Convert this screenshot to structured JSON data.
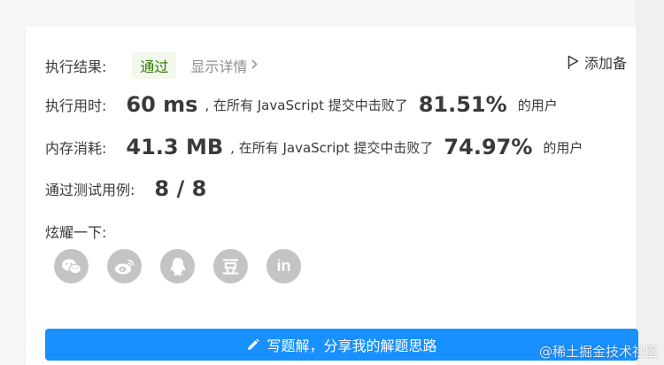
{
  "result": {
    "label": "执行结果:",
    "status": "通过",
    "details_link": "显示详情",
    "add_note": "添加备"
  },
  "runtime": {
    "label": "执行用时:",
    "value": "60 ms",
    "middle_text": ", 在所有 JavaScript 提交中击败了",
    "percent": "81.51%",
    "suffix": "的用户"
  },
  "memory": {
    "label": "内存消耗:",
    "value": "41.3 MB",
    "middle_text": ", 在所有 JavaScript 提交中击败了",
    "percent": "74.97%",
    "suffix": "的用户"
  },
  "testcases": {
    "label": "通过测试用例:",
    "value": "8 / 8"
  },
  "share": {
    "label": "炫耀一下:",
    "icons": [
      "wechat-icon",
      "weibo-icon",
      "qq-icon",
      "douban-icon",
      "linkedin-icon"
    ],
    "douban_glyph": "豆",
    "linkedin_glyph": "in"
  },
  "write_solution": {
    "label": "写题解，分享我的解题思路"
  },
  "watermark": "@稀土掘金技术社区",
  "colors": {
    "primary": "#1890ff",
    "success_text": "#2d7a00",
    "success_bg": "#f2f9ec",
    "icon_gray": "#c4c4c4"
  }
}
